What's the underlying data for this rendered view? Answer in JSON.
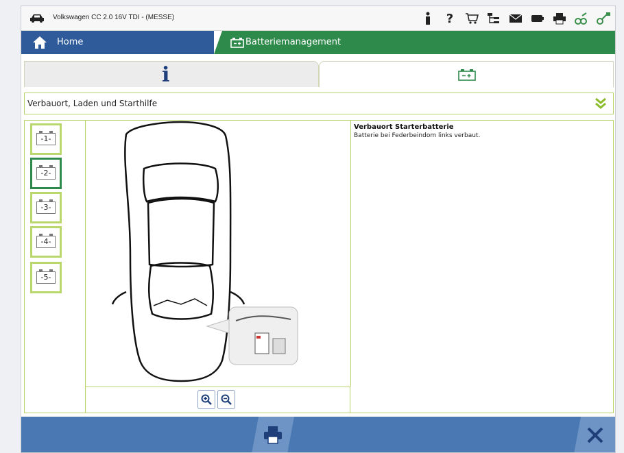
{
  "window": {
    "title": "Volkswagen CC 2.0 16V TDI - (MESSE)"
  },
  "toolbar_icons": [
    "person-icon",
    "help-icon",
    "cart-icon",
    "tree-icon",
    "mail-icon",
    "battery-status-icon",
    "print-icon",
    "connect-icon",
    "network-icon"
  ],
  "nav": {
    "home_label": "Home",
    "module_label": "Batteriemanagement"
  },
  "tabs": {
    "info_glyph": "i"
  },
  "section": {
    "title": "Verbauort, Laden und Starthilfe"
  },
  "battery_buttons": [
    {
      "label": "-1-"
    },
    {
      "label": "-2-"
    },
    {
      "label": "-3-"
    },
    {
      "label": "-4-"
    },
    {
      "label": "-5-"
    }
  ],
  "description": {
    "title": "Verbauort Starterbatterie",
    "body": "Batterie bei Federbeindom links verbaut."
  },
  "colors": {
    "home": "#2f5b9b",
    "module": "#2e8a4b",
    "accent_green": "#b8d36a",
    "bottom": "#4a78b3"
  }
}
